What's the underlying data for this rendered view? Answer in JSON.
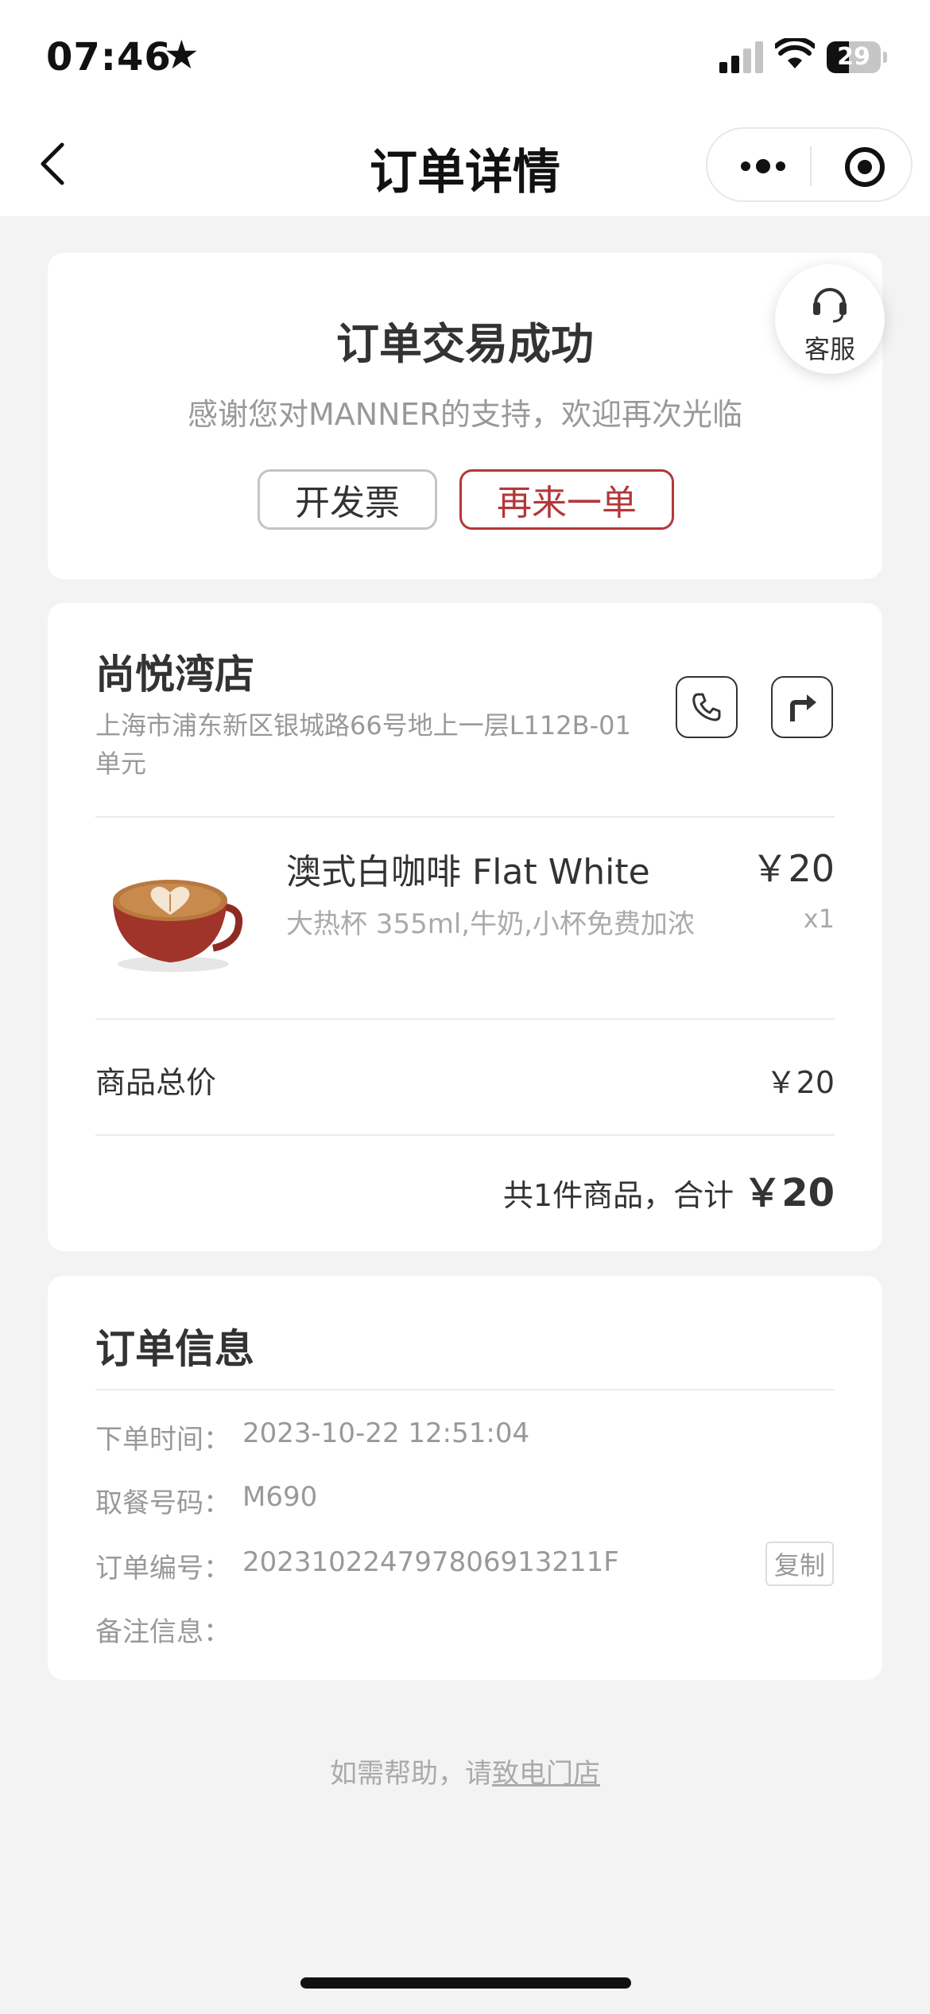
{
  "status_bar": {
    "time": "07:46",
    "battery": "29"
  },
  "nav": {
    "title": "订单详情"
  },
  "status_card": {
    "title": "订单交易成功",
    "message": "感谢您对MANNER的支持，欢迎再次光临",
    "invoice_label": "开发票",
    "reorder_label": "再来一单"
  },
  "customer_service": {
    "label": "客服"
  },
  "store": {
    "name": "尚悦湾店",
    "address": "上海市浦东新区银城路66号地上一层L112B-01单元"
  },
  "items": [
    {
      "name": "澳式白咖啡 Flat White",
      "options": "大热杯 355ml,牛奶,小杯免费加浓",
      "price": "￥20",
      "qty": "x1"
    }
  ],
  "summary": {
    "subtotal_label": "商品总价",
    "subtotal_value": "￥20",
    "total_prefix": "共1件商品，合计 ",
    "total_value": "￥20"
  },
  "order_info": {
    "title": "订单信息",
    "rows": [
      {
        "label": "下单时间：",
        "value": "2023-10-22 12:51:04"
      },
      {
        "label": "取餐号码：",
        "value": "M690"
      },
      {
        "label": "订单编号：",
        "value": "20231022479780691321​1F"
      },
      {
        "label": "备注信息：",
        "value": ""
      }
    ],
    "copy_label": "复制"
  },
  "footer": {
    "prefix": "如需帮助，请",
    "link": "致电门店"
  },
  "colors": {
    "accent": "#b3373a",
    "background": "#f3f3f3"
  }
}
